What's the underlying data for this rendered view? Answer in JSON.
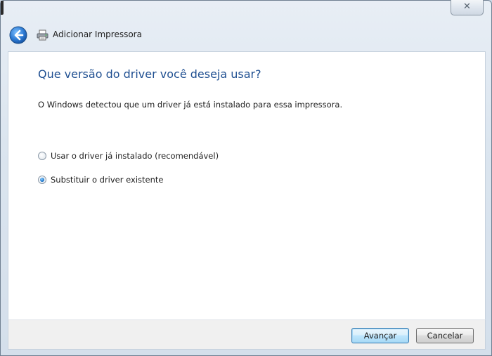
{
  "window": {
    "title": "Adicionar Impressora",
    "close_label": "✕"
  },
  "main": {
    "heading": "Que versão do driver você deseja usar?",
    "description": "O Windows detectou que um driver já está instalado para essa impressora.",
    "options": [
      {
        "label": "Usar o driver já instalado (recomendável)",
        "checked": false
      },
      {
        "label": "Substituir o driver existente",
        "checked": true
      }
    ]
  },
  "footer": {
    "next_label": "Avançar",
    "cancel_label": "Cancelar"
  },
  "colors": {
    "heading": "#1f4f91",
    "back_button": "#2e7bd4"
  },
  "icons": {
    "back": "arrow-left-icon",
    "printer": "printer-icon",
    "close": "close-icon"
  }
}
